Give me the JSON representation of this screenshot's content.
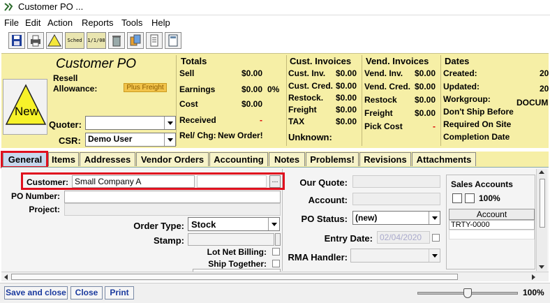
{
  "window": {
    "title": "Customer PO ..."
  },
  "menu": [
    "File",
    "Edit",
    "Action",
    "Reports",
    "Tools",
    "Help"
  ],
  "toolbar": {
    "sched_label": "Sched",
    "date_label": "1/1/08"
  },
  "header": {
    "heading": "Customer PO",
    "status_badge": "New",
    "resell_label": "Resell",
    "allowance_label": "Allowance:",
    "plus_freight": "Plus Freight",
    "quoter_label": "Quoter:",
    "quoter_value": "",
    "csr_label": "CSR:",
    "csr_value": "Demo User"
  },
  "totals": {
    "title": "Totals",
    "sell_label": "Sell",
    "sell_value": "$0.00",
    "earnings_label": "Earnings",
    "earnings_value": "$0.00",
    "earnings_pct": "0%",
    "cost_label": "Cost",
    "cost_value": "$0.00",
    "received_label": "Received",
    "received_value": "-",
    "relchg_label": "Rel/ Chg:",
    "relchg_value": "New Order!"
  },
  "cust_invoices": {
    "title": "Cust. Invoices",
    "rows": [
      {
        "label": "Cust. Inv.",
        "value": "$0.00"
      },
      {
        "label": "Cust. Cred.",
        "value": "$0.00"
      },
      {
        "label": "Restock.",
        "value": "$0.00"
      },
      {
        "label": "Freight",
        "value": "$0.00"
      },
      {
        "label": "TAX",
        "value": "$0.00"
      }
    ],
    "unknown_label": "Unknown:"
  },
  "vend_invoices": {
    "title": "Vend. Invoices",
    "rows": [
      {
        "label": "Vend. Inv.",
        "value": "$0.00"
      },
      {
        "label": "Vend. Cred.",
        "value": "$0.00"
      },
      {
        "label": "Restock",
        "value": "$0.00"
      },
      {
        "label": "Freight",
        "value": "$0.00"
      }
    ],
    "pickcost_label": "Pick Cost",
    "pickcost_value": "-"
  },
  "dates": {
    "title": "Dates",
    "created_label": "Created:",
    "created_value": "20",
    "updated_label": "Updated:",
    "updated_value": "20",
    "workgroup_label": "Workgroup:",
    "workgroup_value": "DOCUM",
    "dont_ship_label": "Don't Ship Before",
    "required_label": "Required On Site",
    "completion_label": "Completion Date"
  },
  "tabs": [
    "General",
    "Items",
    "Addresses",
    "Vendor Orders",
    "Accounting",
    "Notes",
    "Problems!",
    "Revisions",
    "Attachments"
  ],
  "general": {
    "customer_label": "Customer:",
    "customer_value": "Small Company A",
    "po_number_label": "PO Number:",
    "po_number_value": "",
    "project_label": "Project:",
    "project_value": "",
    "order_type_label": "Order Type:",
    "order_type_value": "Stock",
    "stamp_label": "Stamp:",
    "lot_net_label": "Lot Net Billing:",
    "ship_together_label": "Ship Together:",
    "our_quote_label": "Our Quote:",
    "account_label": "Account:",
    "po_status_label": "PO Status:",
    "po_status_value": "(new)",
    "entry_date_label": "Entry Date:",
    "entry_date_value": "02/04/2020",
    "rma_label": "RMA Handler:"
  },
  "sales_accounts": {
    "title": "Sales Accounts",
    "percent": "100%",
    "column": "Account",
    "rows": [
      "TRTY-0000"
    ]
  },
  "footer": {
    "save_close": "Save and close",
    "close": "Close",
    "print": "Print",
    "zoom": "100%",
    "zoom_level": 0.5
  }
}
